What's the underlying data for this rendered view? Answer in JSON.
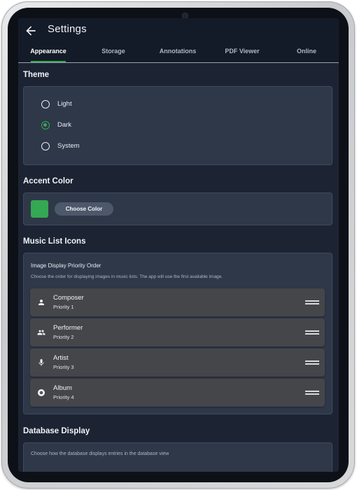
{
  "appbar": {
    "title": "Settings",
    "back_icon": "arrow-left-icon"
  },
  "tabs": [
    {
      "label": "Appearance",
      "active": true
    },
    {
      "label": "Storage",
      "active": false
    },
    {
      "label": "Annotations",
      "active": false
    },
    {
      "label": "PDF Viewer",
      "active": false
    },
    {
      "label": "Online",
      "active": false
    }
  ],
  "theme": {
    "title": "Theme",
    "options": [
      "Light",
      "Dark",
      "System"
    ],
    "selected": "Dark"
  },
  "accent": {
    "title": "Accent Color",
    "color": "#34a853",
    "button_label": "Choose Color"
  },
  "music_icons": {
    "title": "Music List Icons",
    "heading": "Image Display Priority Order",
    "description": "Choose the order for displaying images in music lists. The app will use the first available image.",
    "items": [
      {
        "name": "Composer",
        "priority": "Priority 1",
        "icon": "person-icon"
      },
      {
        "name": "Performer",
        "priority": "Priority 2",
        "icon": "group-icon"
      },
      {
        "name": "Artist",
        "priority": "Priority 3",
        "icon": "microphone-icon"
      },
      {
        "name": "Album",
        "priority": "Priority 4",
        "icon": "album-disc-icon"
      }
    ]
  },
  "database": {
    "title": "Database Display",
    "description": "Choose how the database displays entries in the database view"
  },
  "colors": {
    "background": "#1c2433",
    "card": "#2e3849",
    "accent": "#34a853",
    "item": "#45464a"
  }
}
